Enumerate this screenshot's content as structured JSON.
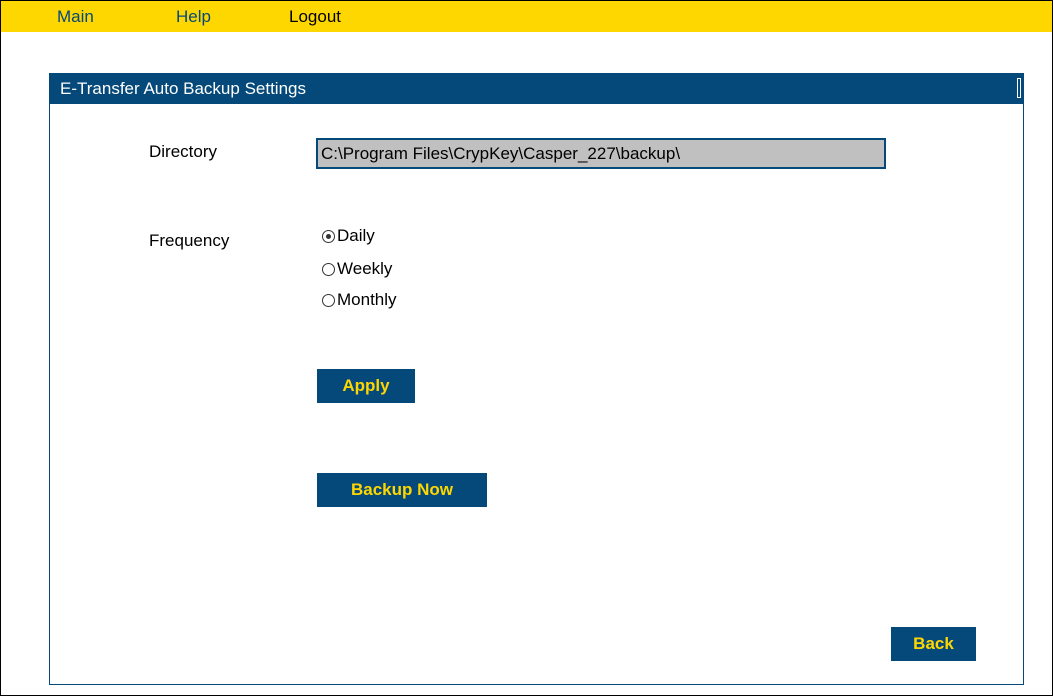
{
  "nav": {
    "main_label": "Main",
    "help_label": "Help",
    "logout_label": "Logout"
  },
  "panel": {
    "title": "E-Transfer Auto Backup Settings"
  },
  "directory": {
    "label": "Directory",
    "value": "C:\\Program Files\\CrypKey\\Casper_227\\backup\\"
  },
  "frequency": {
    "label": "Frequency",
    "options": [
      {
        "label": "Daily",
        "selected": true
      },
      {
        "label": "Weekly",
        "selected": false
      },
      {
        "label": "Monthly",
        "selected": false
      }
    ]
  },
  "actions": {
    "apply_label": "Apply",
    "backup_now_label": "Backup Now",
    "back_label": "Back"
  },
  "colors": {
    "topbar": "#ffd700",
    "panel_header": "#05487a",
    "button_bg": "#05487a",
    "button_text": "#ffd700",
    "input_bg": "#c0c0c0"
  }
}
